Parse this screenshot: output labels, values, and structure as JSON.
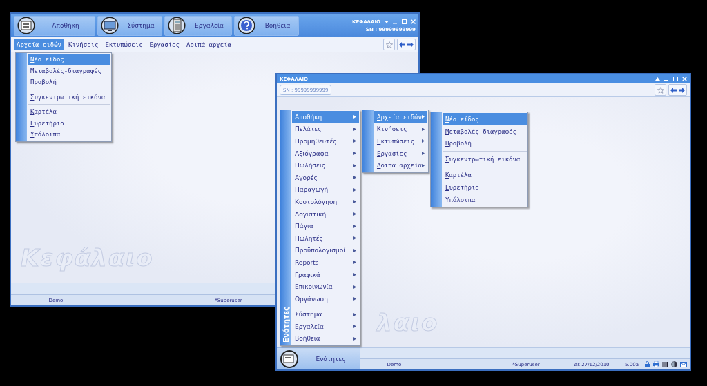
{
  "left_window": {
    "toolbar_buttons": [
      {
        "label": "Αποθήκη"
      },
      {
        "label": "Σύστημα"
      },
      {
        "label": "Εργαλεία"
      },
      {
        "label": "Βοήθεια"
      }
    ],
    "app_name": "ΚΕΦΑΛΑΙΟ",
    "serial": "SN : 99999999999",
    "menu_bar": [
      {
        "label": "Αρχεία ειδών",
        "selected": true
      },
      {
        "label": "Κινήσεις",
        "selected": false
      },
      {
        "label": "Εκτυπώσεις",
        "selected": false
      },
      {
        "label": "Εργασίες",
        "selected": false
      },
      {
        "label": "Λοιπά αρχεία",
        "selected": false
      }
    ],
    "dropdown": [
      {
        "kind": "item",
        "label": "Νέο είδος",
        "selected": true,
        "submenu": false
      },
      {
        "kind": "item",
        "label": "Μεταβολές-διαγραφές",
        "selected": false,
        "submenu": false
      },
      {
        "kind": "item",
        "label": "Προβολή",
        "selected": false,
        "submenu": false
      },
      {
        "kind": "separator"
      },
      {
        "kind": "item",
        "label": "Συγκεντρωτική εικόνα",
        "selected": false,
        "submenu": false
      },
      {
        "kind": "separator"
      },
      {
        "kind": "item",
        "label": "Καρτέλα",
        "selected": false,
        "submenu": false
      },
      {
        "kind": "item",
        "label": "Ευρετήριο",
        "selected": false,
        "submenu": false
      },
      {
        "kind": "item",
        "label": "Υπόλοιπα",
        "selected": false,
        "submenu": false
      }
    ],
    "watermark": "Κεφάλαιο",
    "status_bar": [
      "Demo",
      "*Superuser"
    ]
  },
  "right_window": {
    "title": "ΚΕΦΑΛΑΙΟ",
    "serial": "SN : 99999999999",
    "start_menu": {
      "side_label": "Ενότητες",
      "items": [
        {
          "kind": "item",
          "label": "Αποθήκη",
          "selected": true,
          "submenu": true
        },
        {
          "kind": "item",
          "label": "Πελάτες",
          "selected": false,
          "submenu": true
        },
        {
          "kind": "item",
          "label": "Προμηθευτές",
          "selected": false,
          "submenu": true
        },
        {
          "kind": "item",
          "label": "Αξιόγραφα",
          "selected": false,
          "submenu": true
        },
        {
          "kind": "item",
          "label": "Πωλήσεις",
          "selected": false,
          "submenu": true
        },
        {
          "kind": "item",
          "label": "Αγορές",
          "selected": false,
          "submenu": true
        },
        {
          "kind": "item",
          "label": "Παραγωγή",
          "selected": false,
          "submenu": true
        },
        {
          "kind": "item",
          "label": "Κοστολόγηση",
          "selected": false,
          "submenu": true
        },
        {
          "kind": "item",
          "label": "Λογιστική",
          "selected": false,
          "submenu": true
        },
        {
          "kind": "item",
          "label": "Πάγια",
          "selected": false,
          "submenu": true
        },
        {
          "kind": "item",
          "label": "Πωλητές",
          "selected": false,
          "submenu": true
        },
        {
          "kind": "item",
          "label": "Προϋπολογισμοί",
          "selected": false,
          "submenu": true
        },
        {
          "kind": "item",
          "label": "Reports",
          "selected": false,
          "submenu": true
        },
        {
          "kind": "item",
          "label": "Γραφικά",
          "selected": false,
          "submenu": true
        },
        {
          "kind": "item",
          "label": "Επικοινωνία",
          "selected": false,
          "submenu": true
        },
        {
          "kind": "item",
          "label": "Οργάνωση",
          "selected": false,
          "submenu": true
        },
        {
          "kind": "separator"
        },
        {
          "kind": "item",
          "label": "Σύστημα",
          "selected": false,
          "submenu": true
        },
        {
          "kind": "item",
          "label": "Εργαλεία",
          "selected": false,
          "submenu": true
        },
        {
          "kind": "item",
          "label": "Βοήθεια",
          "selected": false,
          "submenu": true
        }
      ]
    },
    "submenu": [
      {
        "kind": "item",
        "label": "Αρχεία ειδών",
        "selected": true,
        "submenu": true
      },
      {
        "kind": "item",
        "label": "Κινήσεις",
        "selected": false,
        "submenu": true
      },
      {
        "kind": "item",
        "label": "Εκτυπώσεις",
        "selected": false,
        "submenu": true
      },
      {
        "kind": "item",
        "label": "Εργασίες",
        "selected": false,
        "submenu": true
      },
      {
        "kind": "item",
        "label": "Λοιπά αρχεία",
        "selected": false,
        "submenu": true
      }
    ],
    "submenu_2": [
      {
        "kind": "item",
        "label": "Νέο είδος",
        "selected": true,
        "submenu": false
      },
      {
        "kind": "item",
        "label": "Μεταβολές-διαγραφές",
        "selected": false,
        "submenu": false
      },
      {
        "kind": "item",
        "label": "Προβολή",
        "selected": false,
        "submenu": false
      },
      {
        "kind": "separator"
      },
      {
        "kind": "item",
        "label": "Συγκεντρωτική εικόνα",
        "selected": false,
        "submenu": false
      },
      {
        "kind": "separator"
      },
      {
        "kind": "item",
        "label": "Καρτέλα",
        "selected": false,
        "submenu": false
      },
      {
        "kind": "item",
        "label": "Ευρετήριο",
        "selected": false,
        "submenu": false
      },
      {
        "kind": "item",
        "label": "Υπόλοιπα",
        "selected": false,
        "submenu": false
      }
    ],
    "watermark": "λαιο",
    "start_button": "Ενότητες",
    "status_bar": [
      "Demo",
      "*Superuser",
      "Δε 27/12/2010",
      "5.00a"
    ]
  }
}
